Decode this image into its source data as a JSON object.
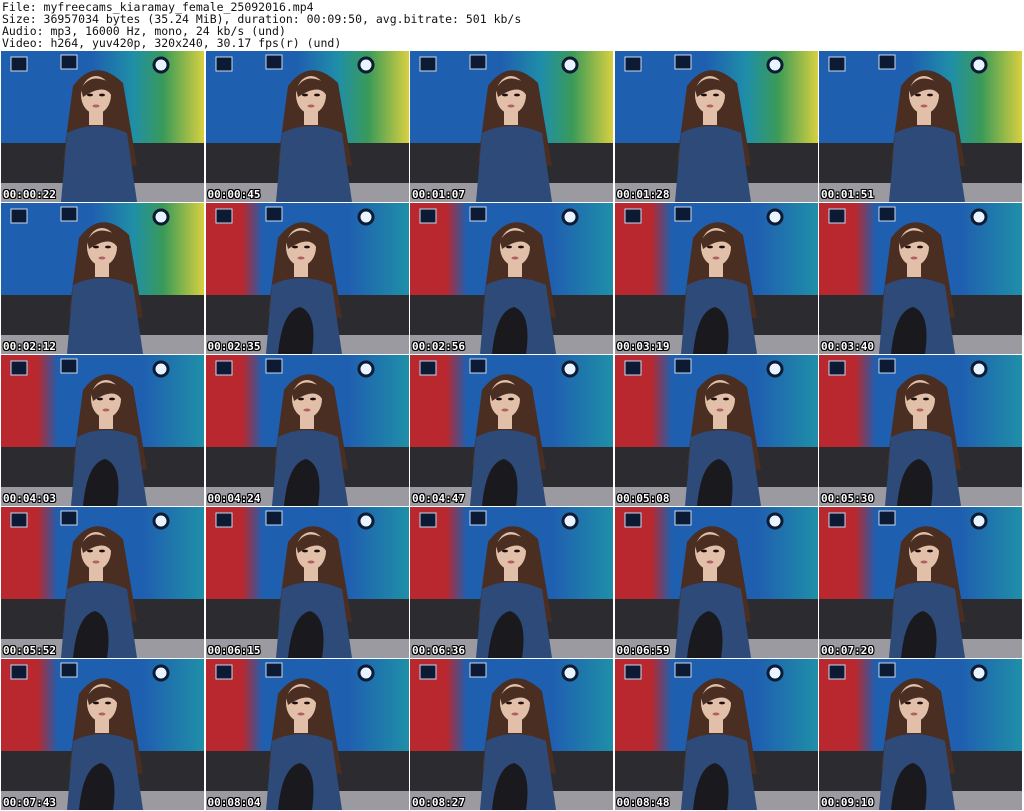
{
  "header": {
    "file_line": "File: myfreecams_kiaramay_female_25092016.mp4",
    "size_line": "Size: 36957034 bytes (35.24 MiB), duration: 00:09:50, avg.bitrate: 501 kb/s",
    "audio_line": "Audio: mp3, 16000 Hz, mono, 24 kb/s (und)",
    "video_line": "Video: h264, yuv420p, 320x240, 30.17 fps(r) (und)"
  },
  "thumbnails": [
    {
      "timestamp": "00:00:22",
      "variant": "rainbow"
    },
    {
      "timestamp": "00:00:45",
      "variant": "rainbow"
    },
    {
      "timestamp": "00:01:07",
      "variant": "rainbow"
    },
    {
      "timestamp": "00:01:28",
      "variant": "rainbow"
    },
    {
      "timestamp": "00:01:51",
      "variant": "rainbow"
    },
    {
      "timestamp": "00:02:12",
      "variant": "rainbow"
    },
    {
      "timestamp": "00:02:35",
      "variant": "redblue"
    },
    {
      "timestamp": "00:02:56",
      "variant": "redblue"
    },
    {
      "timestamp": "00:03:19",
      "variant": "redblue"
    },
    {
      "timestamp": "00:03:40",
      "variant": "redblue"
    },
    {
      "timestamp": "00:04:03",
      "variant": "redblue"
    },
    {
      "timestamp": "00:04:24",
      "variant": "redblue"
    },
    {
      "timestamp": "00:04:47",
      "variant": "redblue"
    },
    {
      "timestamp": "00:05:08",
      "variant": "redblue"
    },
    {
      "timestamp": "00:05:30",
      "variant": "redblue"
    },
    {
      "timestamp": "00:05:52",
      "variant": "redblue"
    },
    {
      "timestamp": "00:06:15",
      "variant": "redblue"
    },
    {
      "timestamp": "00:06:36",
      "variant": "redblue"
    },
    {
      "timestamp": "00:06:59",
      "variant": "redblue"
    },
    {
      "timestamp": "00:07:20",
      "variant": "redblue"
    },
    {
      "timestamp": "00:07:43",
      "variant": "redblue"
    },
    {
      "timestamp": "00:08:04",
      "variant": "redblue"
    },
    {
      "timestamp": "00:08:27",
      "variant": "redblue"
    },
    {
      "timestamp": "00:08:48",
      "variant": "redblue"
    },
    {
      "timestamp": "00:09:10",
      "variant": "redblue"
    }
  ],
  "colors": {
    "background": "#ffffff",
    "header_text": "#111111",
    "stamp_text": "#ffffff",
    "stamp_outline": "#000000",
    "wall_red": "#b8282e",
    "wall_blue": "#1f5fb0",
    "wall_teal": "#1f8fa8",
    "wall_yellow": "#d8d040",
    "wall_green": "#3a9a58",
    "sofa": "#2b2b30",
    "shirt": "#2e4a78",
    "hair": "#4a2e22",
    "skin": "#e2bfa8",
    "stockings": "#1a1a1e"
  }
}
